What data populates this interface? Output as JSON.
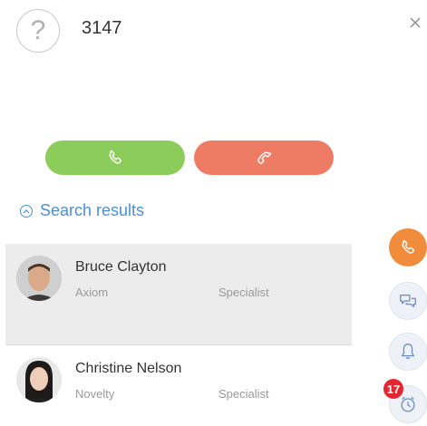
{
  "caller": {
    "unknown_icon": "question-icon",
    "number": "3147",
    "close_icon": "close-icon"
  },
  "call_actions": {
    "answer_icon": "phone-icon",
    "decline_icon": "phone-hangup-icon",
    "colors": {
      "answer": "#8ccc5b",
      "decline": "#ee7b63"
    }
  },
  "search": {
    "toggle_label": "Search results",
    "toggle_icon": "chevron-up-circle-icon",
    "accent": "#4a8fd6"
  },
  "results": [
    {
      "name": "Bruce Clayton",
      "company": "Axiom",
      "role": "Specialist",
      "selected": true
    },
    {
      "name": "Christine Nelson",
      "company": "Novelty",
      "role": "Specialist",
      "selected": false
    }
  ],
  "sidebar": {
    "items": [
      {
        "icon": "phone-icon",
        "active": true,
        "color": "#f08c3c"
      },
      {
        "icon": "chat-icon",
        "active": false
      },
      {
        "icon": "bell-icon",
        "active": false
      },
      {
        "icon": "timer-icon",
        "active": false,
        "badge": "17"
      }
    ]
  }
}
